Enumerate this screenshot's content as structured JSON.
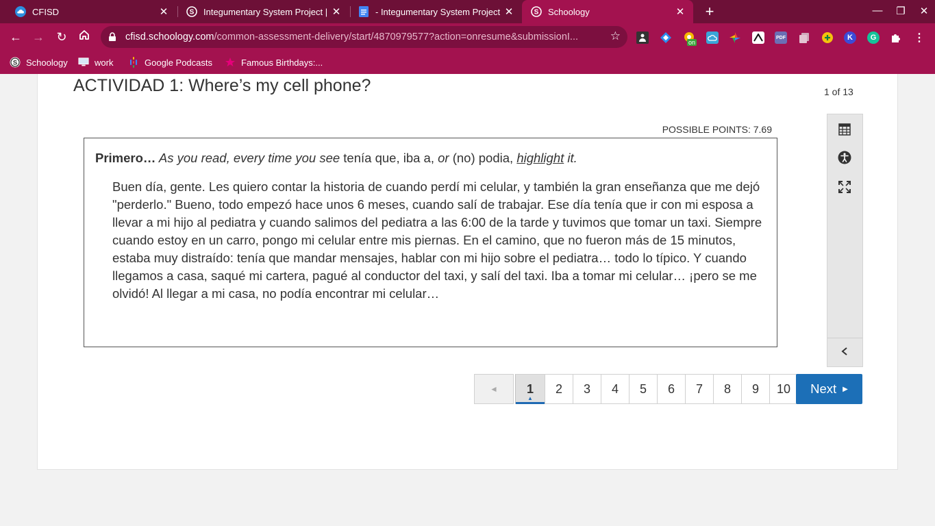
{
  "browser": {
    "tabs": [
      {
        "title": "CFISD",
        "active": false
      },
      {
        "title": "Integumentary System Project | S",
        "active": false
      },
      {
        "title": "- Integumentary System Project -",
        "active": false
      },
      {
        "title": "Schoology",
        "active": true
      }
    ],
    "address": {
      "host": "cfisd.schoology.com",
      "path": "/common-assessment-delivery/start/4870979577?action=onresume&submissionI..."
    },
    "extensions": [
      "extension-icon-1",
      "extension-icon-2",
      "extension-icon-3",
      "extension-icon-4",
      "extension-icon-5",
      "extension-icon-6",
      "extension-icon-7",
      "extension-icon-8",
      "extension-icon-9",
      "extension-icon-10",
      "extension-icon-11",
      "extensions-puzzle-icon"
    ],
    "extension_badge": "on",
    "bookmarks": [
      {
        "label": "Schoology"
      },
      {
        "label": "work"
      },
      {
        "label": "Google Podcasts"
      },
      {
        "label": "Famous Birthdays:..."
      }
    ],
    "colors": {
      "frame": "#6d1037",
      "toolbar": "#a3124f"
    }
  },
  "assessment": {
    "title": "ACTIVIDAD 1: Where’s my cell phone?",
    "counter": "1 of 13",
    "possible_points": "POSSIBLE POINTS: 7.69",
    "instruction": {
      "bold": "Primero…",
      "italic1": " As you read, every time you see",
      "plain1": " tenía que,",
      "plain2": " iba a,",
      "italic2": " or",
      "plain3": " (no) podia,",
      "underline": "highlight",
      "italic3": " it."
    },
    "passage": "Buen día, gente. Les quiero contar la historia de cuando perdí mi celular, y también la gran enseñanza que me dejó \"perderlo.\" Bueno, todo empezó hace unos 6 meses, cuando salí de trabajar.  Ese día tenía que ir con mi esposa a llevar a mi hijo al pediatra y cuando salimos del pediatra a las 6:00 de la tarde y tuvimos que tomar un taxi.  Siempre cuando estoy en un carro, pongo mi celular entre mis piernas.  En el camino, que no fueron más de 15 minutos, estaba muy distraído: tenía que mandar mensajes, hablar con mi hijo sobre el pediatra… todo lo típico.  Y cuando llegamos a casa, saqué mi cartera, pagué al conductor del taxi, y salí del taxi.  Iba a tomar mi celular… ¡pero se me olvidó!  Al llegar a mi casa, no podía encontrar mi celular…",
    "pager": {
      "prev_glyph": "◄",
      "pages": [
        "1",
        "2",
        "3",
        "4",
        "5",
        "6",
        "7",
        "8",
        "9",
        "10"
      ],
      "current": "1",
      "next_label": "Next",
      "next_glyph": "▶"
    },
    "tools": [
      "calculator-icon",
      "accessibility-icon",
      "fullscreen-icon",
      "collapse-chevron-icon"
    ],
    "colors": {
      "accent": "#1c6fb7"
    }
  }
}
